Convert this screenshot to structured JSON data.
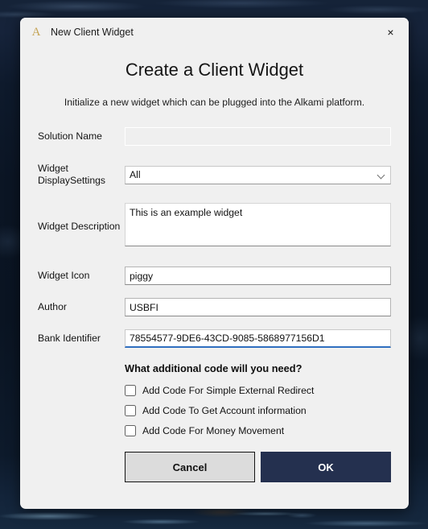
{
  "window": {
    "title": "New Client Widget",
    "logo_icon": "alkami-a-logo-icon",
    "close_icon": "×"
  },
  "header": {
    "title": "Create a Client Widget",
    "subtitle": "Initialize a new widget which can be plugged into the Alkami platform."
  },
  "form": {
    "solution_name": {
      "label": "Solution Name",
      "value": "",
      "placeholder": "",
      "disabled": true
    },
    "widget_display_settings": {
      "label": "Widget DisplaySettings",
      "label_line1": "Widget",
      "label_line2": "DisplaySettings",
      "value": "All",
      "options": [
        "All"
      ],
      "chevron_icon": "chevron-down-icon"
    },
    "widget_description": {
      "label": "Widget Description",
      "value": "This is an example widget",
      "placeholder": ""
    },
    "widget_icon": {
      "label": "Widget Icon",
      "value": "piggy",
      "placeholder": ""
    },
    "author": {
      "label": "Author",
      "value": "USBFI",
      "placeholder": ""
    },
    "bank_identifier": {
      "label": "Bank Identifier",
      "value": "78554577-9DE6-43CD-9085-5868977156D1",
      "placeholder": "",
      "focused": true
    }
  },
  "extra_code": {
    "heading": "What additional code will you need?",
    "options": [
      {
        "label": "Add Code For Simple External Redirect",
        "checked": false
      },
      {
        "label": "Add Code To Get Account information",
        "checked": false
      },
      {
        "label": "Add Code For Money Movement",
        "checked": false
      }
    ]
  },
  "footer": {
    "cancel_label": "Cancel",
    "ok_label": "OK"
  },
  "colors": {
    "dialog_background": "#f0f0f0",
    "ok_button": "#24304f",
    "cancel_button": "#dcdcdc",
    "focus_underline": "#2f6fc0",
    "logo_gold": "#c5a455",
    "desktop": "#0b1524"
  }
}
